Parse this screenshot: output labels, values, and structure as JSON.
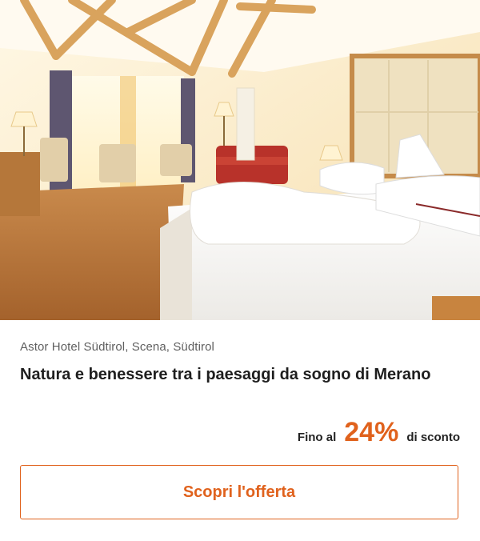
{
  "hero": {
    "image_name": "hotel-room-photo"
  },
  "offer": {
    "location": "Astor Hotel Südtirol, Scena, Südtirol",
    "title": "Natura e benessere tra i paesaggi da sogno di Merano",
    "discount_prefix": "Fino al",
    "discount_value": "24%",
    "discount_suffix": "di sconto",
    "cta_label": "Scopri l'offerta"
  },
  "colors": {
    "accent": "#e0621d",
    "title_text": "#1e1e1e",
    "secondary_text": "#5f5f5f"
  }
}
